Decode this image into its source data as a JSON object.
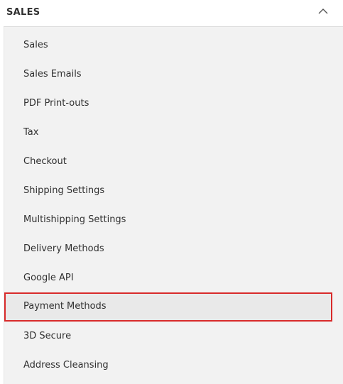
{
  "section": {
    "title": "SALES",
    "collapse_icon": "chevron-up-icon"
  },
  "menu": {
    "active_item": "Payment Methods",
    "highlight_color": "#d82a2a",
    "items": [
      {
        "label": "Sales"
      },
      {
        "label": "Sales Emails"
      },
      {
        "label": "PDF Print-outs"
      },
      {
        "label": "Tax"
      },
      {
        "label": "Checkout"
      },
      {
        "label": "Shipping Settings"
      },
      {
        "label": "Multishipping Settings"
      },
      {
        "label": "Delivery Methods"
      },
      {
        "label": "Google API"
      },
      {
        "label": "Payment Methods"
      },
      {
        "label": "3D Secure"
      },
      {
        "label": "Address Cleansing"
      }
    ]
  }
}
